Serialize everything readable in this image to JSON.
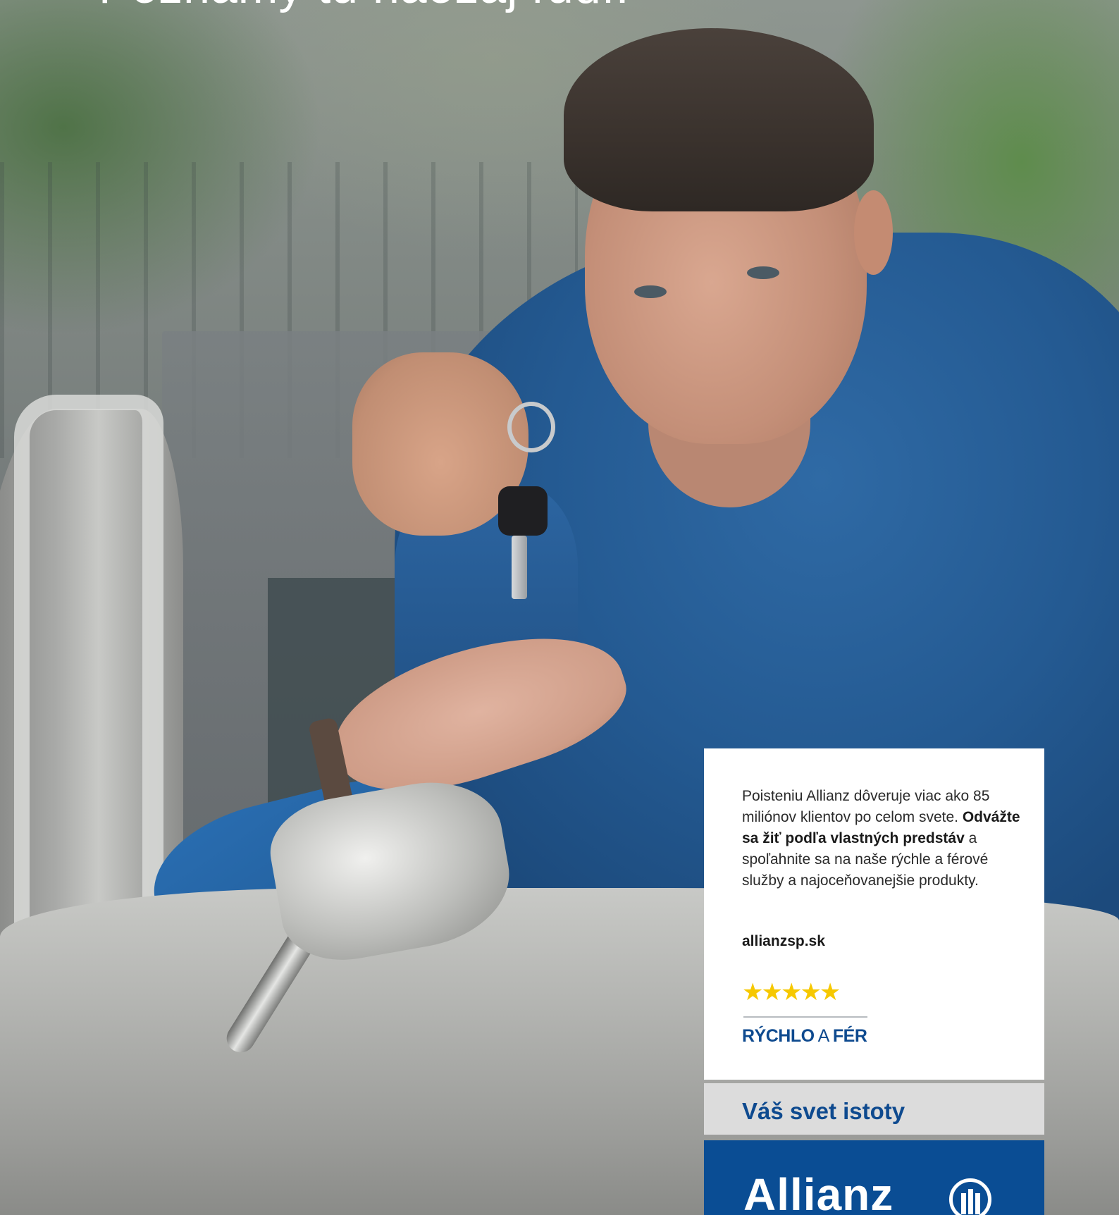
{
  "headline": "Poznámy tu naozaj ľudí.",
  "card": {
    "body_intro": "Poisteniu Allianz dôveruje viac ako 85 miliónov klientov po celom svete.",
    "body_bold": "Odvážte sa žiť podľa vlastných predstáv",
    "body_rest": "a spoľahnite sa na naše rýchle a férové služby a najoceňovanejšie produkty.",
    "url": "allianzsp.sk",
    "rating": {
      "stars_text": "★★★★★",
      "stars_count": 5,
      "star_color": "#f6c800"
    },
    "tagline": {
      "part1": "RÝCHLO",
      "part2": "A",
      "part3": "FÉR"
    },
    "slogan": "Váš svet istoty",
    "brand_name": "Allianz",
    "brand_colors": {
      "blue": "#0a4d94",
      "grey_band": "#dcdcdc",
      "text_blue": "#0e4a8f"
    }
  }
}
